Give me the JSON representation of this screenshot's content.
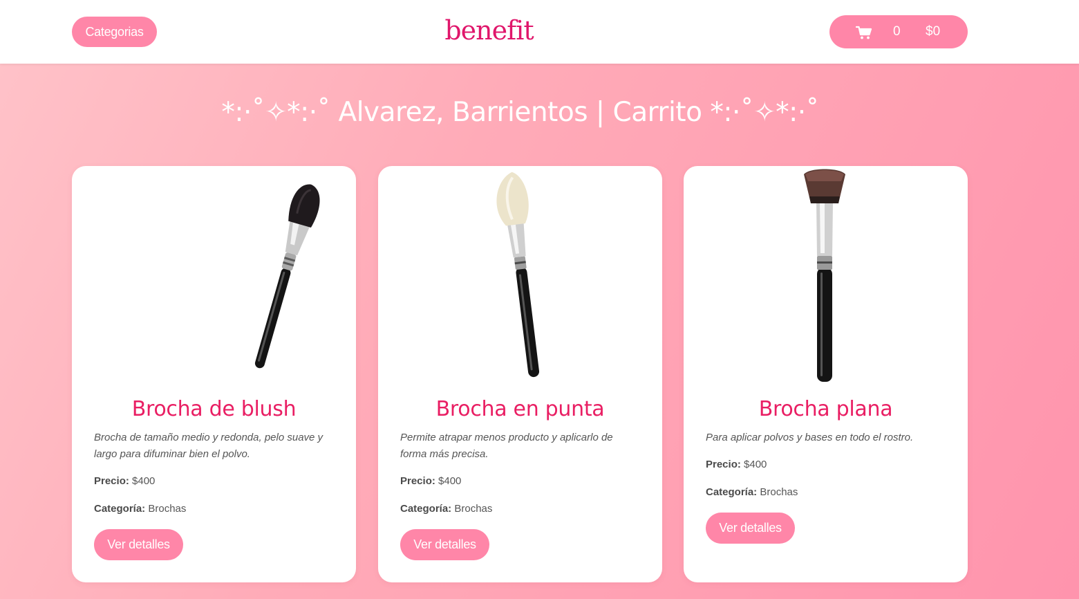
{
  "nav": {
    "categories_label": "Categorias",
    "logo_text": "benefit",
    "cart_icon": "shopping-cart-icon",
    "cart_count": "0",
    "cart_total": "$0"
  },
  "page_title": "*:·˚✧*:·˚ Alvarez, Barrientos | Carrito *:·˚✧*:·˚",
  "labels": {
    "price": "Precio:",
    "category": "Categoría:",
    "details_button": "Ver detalles"
  },
  "products": [
    {
      "name": "Brocha de blush",
      "description": "Brocha de tamaño medio y redonda, pelo suave y largo para difuminar bien el polvo.",
      "price": "$400",
      "category": "Brochas",
      "image": "blush-brush-image"
    },
    {
      "name": "Brocha en punta",
      "description": "Permite atrapar menos producto y aplicarlo de forma más precisa.",
      "price": "$400",
      "category": "Brochas",
      "image": "pointed-brush-image"
    },
    {
      "name": "Brocha plana",
      "description": "Para aplicar polvos y bases en todo el rostro.",
      "price": "$400",
      "category": "Brochas",
      "image": "flat-brush-image"
    }
  ],
  "colors": {
    "accent": "#ff86a8",
    "brand": "#e0166b",
    "product_title": "#e91e63"
  }
}
